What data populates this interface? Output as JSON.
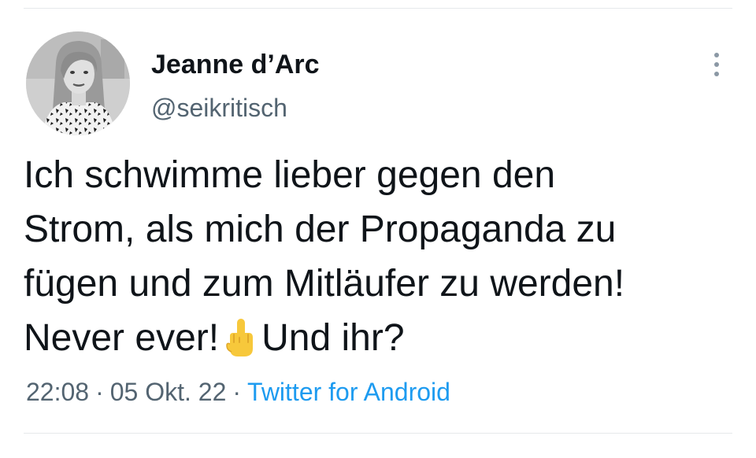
{
  "tweet": {
    "author": {
      "display_name": "Jeanne d’Arc",
      "handle": "@seikritisch",
      "avatar_icon": "profile-photo"
    },
    "text_lines": [
      "Ich schwimme lieber gegen den",
      "Strom, als mich der Propaganda zu",
      "fügen und zum Mitläufer zu werden!"
    ],
    "last_line": {
      "before_emoji": "Never ever!",
      "emoji": "middle-finger-emoji",
      "after_emoji": "Und ihr?"
    },
    "meta": {
      "time": "22:08",
      "separator": "·",
      "date": "05 Okt. 22",
      "source": "Twitter for Android"
    },
    "more_icon": "more-vertical-icon"
  },
  "colors": {
    "text": "#0f1419",
    "secondary": "#536471",
    "link": "#1d9bf0",
    "divider": "#e6e9eb",
    "emoji": "#f7c83b"
  }
}
